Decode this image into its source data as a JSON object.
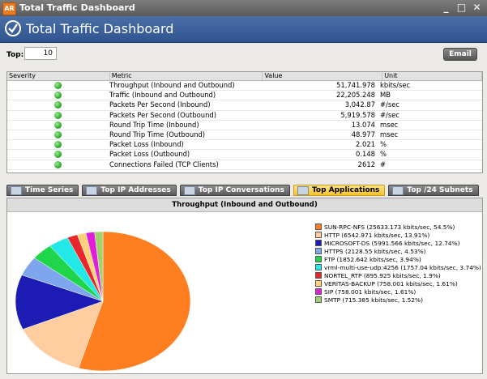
{
  "window": {
    "app_badge": "AR",
    "title": "Total Traffic Dashboard",
    "controls": [
      "_",
      "□",
      "✕"
    ]
  },
  "header": {
    "title": "Total Traffic Dashboard"
  },
  "filter": {
    "top_label": "Top:",
    "top_value": "10",
    "email_label": "Email"
  },
  "table": {
    "headers": [
      "Severity",
      "Metric",
      "Value",
      "Unit"
    ],
    "rows": [
      {
        "metric": "Throughput (Inbound and Outbound)",
        "value": "51,741.978",
        "unit": "kbits/sec"
      },
      {
        "metric": "Traffic (Inbound and Outbound)",
        "value": "22,205.248",
        "unit": "MB"
      },
      {
        "metric": "Packets Per Second (Inbound)",
        "value": "3,042.87",
        "unit": "#/sec"
      },
      {
        "metric": "Packets Per Second (Outbound)",
        "value": "5,919.578",
        "unit": "#/sec"
      },
      {
        "metric": "Round Trip Time (Inbound)",
        "value": "13.074",
        "unit": "msec"
      },
      {
        "metric": "Round Trip Time (Outbound)",
        "value": "48.977",
        "unit": "msec"
      },
      {
        "metric": "Packet Loss (Inbound)",
        "value": "2.021",
        "unit": "%"
      },
      {
        "metric": "Packet Loss (Outbound)",
        "value": "0.148",
        "unit": "%"
      },
      {
        "metric": "Connections Failed (TCP Clients)",
        "value": "2612",
        "unit": "#"
      }
    ]
  },
  "tabs": [
    {
      "label": "Time Series",
      "active": false
    },
    {
      "label": "Top IP Addresses",
      "active": false
    },
    {
      "label": "Top IP Conversations",
      "active": false
    },
    {
      "label": "Top Applications",
      "active": true
    },
    {
      "label": "Top /24 Subnets",
      "active": false
    }
  ],
  "chart_data": {
    "type": "pie",
    "title": "Throughput (Inbound and Outbound)",
    "legend_position": "right",
    "slices": [
      {
        "label": "SUN-RPC-NFS (25633.173 kbits/sec, 54.5%)",
        "value": 54.5,
        "color": "#ff7e1f"
      },
      {
        "label": "HTTP (6542.971 kbits/sec, 13.91%)",
        "value": 13.91,
        "color": "#ffcda0"
      },
      {
        "label": "MICROSOFT-DS (5991.566 kbits/sec, 12.74%)",
        "value": 12.74,
        "color": "#1c1cb4"
      },
      {
        "label": "HTTPS (2128.55 kbits/sec, 4.53%)",
        "value": 4.53,
        "color": "#7ea6ee"
      },
      {
        "label": "FTP (1852.642 kbits/sec, 3.94%)",
        "value": 3.94,
        "color": "#1fd64a"
      },
      {
        "label": "vrml-multi-use-udp:4256 (1757.04 kbits/sec, 3.74%)",
        "value": 3.74,
        "color": "#22e8e8"
      },
      {
        "label": "NORTEL_RTP (895.925 kbits/sec, 1.9%)",
        "value": 1.9,
        "color": "#e8262b"
      },
      {
        "label": "VERITAS-BACKUP (758.001 kbits/sec, 1.61%)",
        "value": 1.61,
        "color": "#ffd27a"
      },
      {
        "label": "SIP (758.001 kbits/sec, 1.61%)",
        "value": 1.61,
        "color": "#e020d8"
      },
      {
        "label": "SMTP (715.385 kbits/sec, 1.52%)",
        "value": 1.52,
        "color": "#9ed36d"
      }
    ]
  }
}
